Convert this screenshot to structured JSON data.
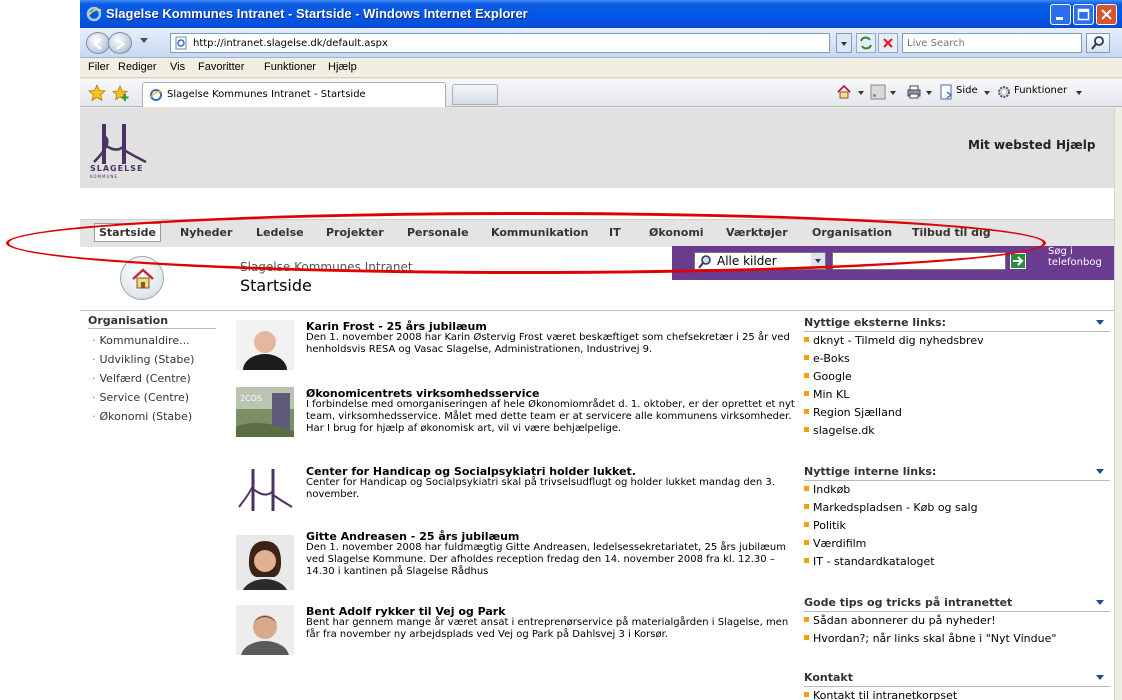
{
  "window": {
    "title": "Slagelse Kommunes Intranet - Startside - Windows Internet Explorer"
  },
  "address_bar": {
    "url": "http://intranet.slagelse.dk/default.aspx",
    "search_placeholder": "Live Search"
  },
  "menu": [
    "Filer",
    "Rediger",
    "Vis",
    "Favoritter",
    "Funktioner",
    "Hjælp"
  ],
  "tab": {
    "label": "Slagelse Kommunes Intranet - Startside"
  },
  "command_bar": {
    "page_label": "Side",
    "tools_label": "Funktioner"
  },
  "header": {
    "logo_text": "SLAGELSE",
    "logo_subtext": "KOMMUNE",
    "links": [
      "Mit websted",
      "Hjælp"
    ]
  },
  "topnav": [
    "Startside",
    "Nyheder",
    "Ledelse",
    "Projekter",
    "Personale",
    "Kommunikation",
    "IT",
    "Økonomi",
    "Værktøjer",
    "Organisation",
    "Tilbud til dig"
  ],
  "search": {
    "scope": "Alle kilder",
    "phonebook": "Søg i telefonbog"
  },
  "title_area": {
    "site_name": "Slagelse Kommunes Intranet",
    "page_title": "Startside"
  },
  "leftnav": {
    "heading": "Organisation",
    "items": [
      "Kommunaldire...",
      "Udvikling (Stabe)",
      "Velfærd (Centre)",
      "Service (Centre)",
      "Økonomi (Stabe)"
    ]
  },
  "news": [
    {
      "title": "Karin Frost - 25 års jubilæum",
      "text": "Den 1. november 2008 har Karin Østervig Frost været beskæftiget som chefsekretær i 25 år ved henholdsvis RESA og Vasac Slagelse, Administrationen, Industrivej 9."
    },
    {
      "title": "Økonomicentrets virksomhedsservice",
      "text": "I forbindelse med omorganiseringen af hele Økonomiområdet d. 1. oktober, er der oprettet et nyt team, virksomhedsservice. Målet med dette team er at servicere alle kommunens virksomheder. Har I brug for hjælp af økonomisk art, vil vi være behjælpelige.",
      "thumb_label": "2COS"
    },
    {
      "title": "Center for Handicap og Socialpsykiatri holder lukket.",
      "text": "Center for Handicap og Socialpsykiatri skal på trivselsudflugt og holder lukket mandag den 3. november."
    },
    {
      "title": "Gitte Andreasen - 25 års jubilæum",
      "text": "Den 1. november 2008 har fuldmægtig Gitte Andreasen, ledelsessekretariatet, 25 års jubilæum ved Slagelse Kommune. Der afholdes reception fredag den 14. november 2008 fra kl. 12.30 – 14.30 i kantinen på Slagelse Rådhus"
    },
    {
      "title": "Bent Adolf rykker til Vej og Park",
      "text": "Bent har gennem mange år været ansat i entreprenørservice på materialgården i Slagelse, men får fra november ny arbejdsplads ved Vej og Park på Dahlsvej 3 i Korsør."
    }
  ],
  "right_boxes": [
    {
      "heading": "Nyttige eksterne links:",
      "links": [
        "dknyt - Tilmeld dig nyhedsbrev",
        "e-Boks",
        "Google",
        "Min KL",
        "Region Sjælland",
        "slagelse.dk"
      ]
    },
    {
      "heading": "Nyttige interne links:",
      "links": [
        "Indkøb",
        "Markedspladsen - Køb og salg",
        "Politik",
        "Værdifilm",
        "IT - standardkataloget"
      ]
    },
    {
      "heading": "Gode tips og tricks på intranettet",
      "links": [
        "Sådan abonnerer du på nyheder!",
        "Hvordan?; når links skal åbne i \"Nyt Vindue\""
      ]
    },
    {
      "heading": "Kontakt",
      "links": [
        "Kontakt til intranetkorpset"
      ]
    }
  ],
  "colors": {
    "accent_purple": "#6b3b8f",
    "title_bar_blue": "#0058e6",
    "bullet_orange": "#f5a10c",
    "annotation_red": "#e10000"
  }
}
